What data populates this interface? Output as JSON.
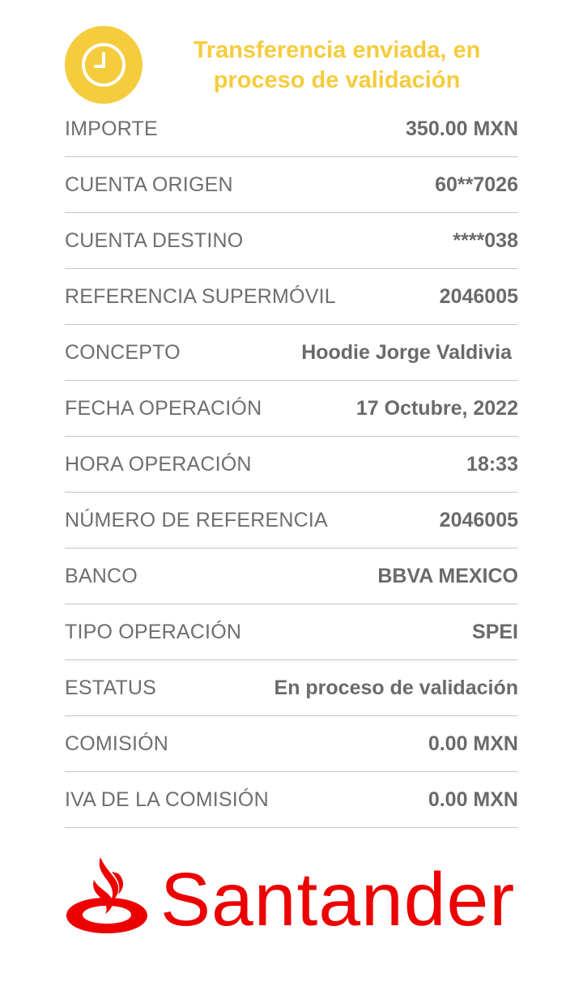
{
  "header": {
    "title_line1": "Transferencia enviada, en",
    "title_line2": "proceso de validación",
    "status_icon": "clock-icon",
    "accent_color": "#F5CC3D"
  },
  "details": [
    {
      "label": "IMPORTE",
      "value": "350.00 MXN"
    },
    {
      "label": "CUENTA ORIGEN",
      "value": "60**7026"
    },
    {
      "label": "CUENTA DESTINO",
      "value": "****038"
    },
    {
      "label": "REFERENCIA SUPERMÓVIL",
      "value": "2046005"
    },
    {
      "label": "CONCEPTO",
      "value": "Hoodie Jorge Valdivia"
    },
    {
      "label": "FECHA OPERACIÓN",
      "value": "17 Octubre, 2022"
    },
    {
      "label": "HORA OPERACIÓN",
      "value": "18:33"
    },
    {
      "label": "NÚMERO DE REFERENCIA",
      "value": "2046005"
    },
    {
      "label": "BANCO",
      "value": "BBVA MEXICO"
    },
    {
      "label": "TIPO OPERACIÓN",
      "value": "SPEI"
    },
    {
      "label": "ESTATUS",
      "value": "En proceso de validación"
    },
    {
      "label": "COMISIÓN",
      "value": "0.00 MXN"
    },
    {
      "label": "IVA DE LA COMISIÓN",
      "value": "0.00 MXN"
    }
  ],
  "brand": {
    "name": "Santander",
    "color": "#EC0000",
    "icon": "santander-flame-icon"
  }
}
